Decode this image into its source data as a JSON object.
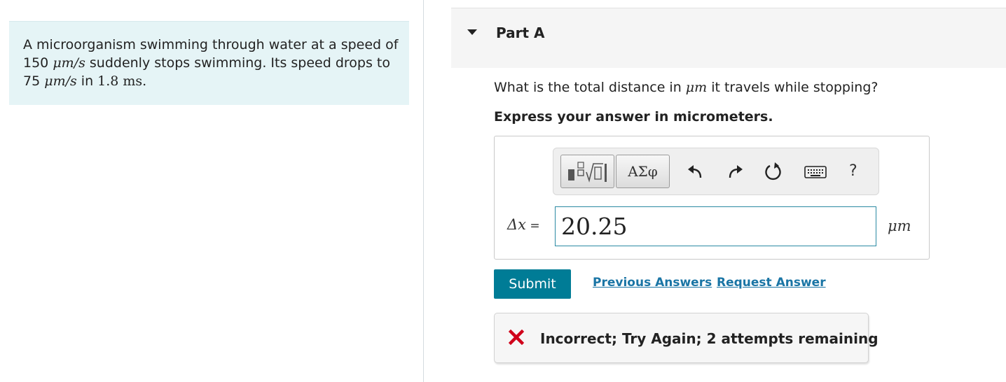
{
  "problem": {
    "line1": "A microorganism swimming through water at a speed of",
    "line2_num": "150 ",
    "line2_unit": "μm/s",
    "line2_rest": " suddenly stops swimming. Its speed drops to",
    "line3_num": "75 ",
    "line3_unit": "μm/s",
    "line3_mid": " in ",
    "line3_time": "1.8 ms."
  },
  "part": {
    "title": "Part A"
  },
  "question": {
    "text_before": "What is the total distance in ",
    "unit": "μm",
    "text_after": " it travels while stopping?",
    "instruction": "Express your answer in micrometers."
  },
  "toolbar": {
    "greek_label": "ΑΣφ",
    "help_label": "?"
  },
  "answer": {
    "variable": "Δx",
    "equals": " = ",
    "value": "20.25",
    "unit": "μm"
  },
  "actions": {
    "submit_label": "Submit",
    "previous_answers_label": "Previous Answers",
    "request_answer_label": "Request Answer"
  },
  "feedback": {
    "message": "Incorrect; Try Again; 2 attempts remaining",
    "status_color": "#d0021b"
  },
  "colors": {
    "accent": "#007c96",
    "link": "#1a75a5",
    "problem_bg": "#e5f4f6"
  }
}
